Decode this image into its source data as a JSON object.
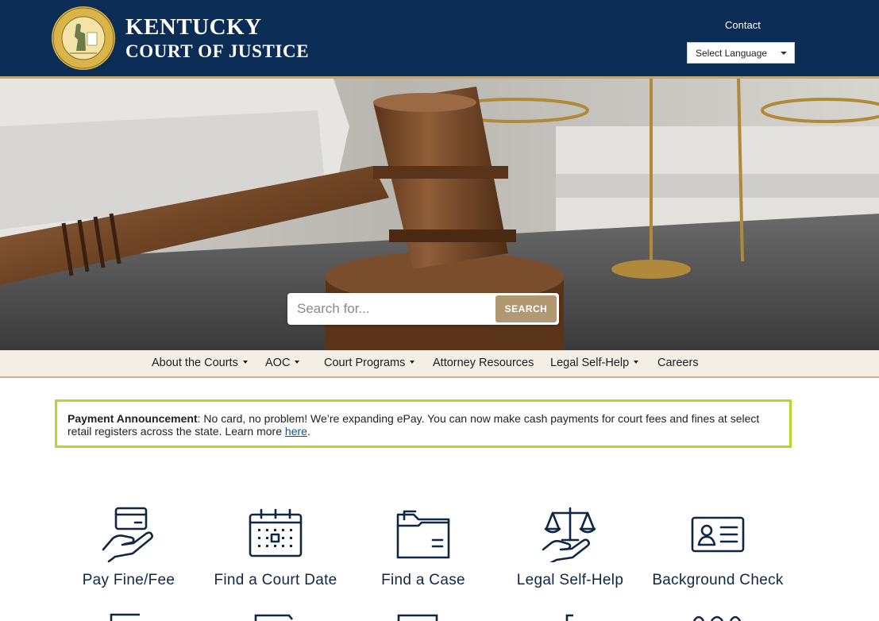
{
  "header": {
    "brand_line1": "KENTUCKY",
    "brand_line2": "COURT OF JUSTICE",
    "seal_icon": "commonwealth-of-kentucky-seal",
    "contact_label": "Contact",
    "language_select": {
      "selected": "Select Language"
    }
  },
  "hero": {
    "image": "gavel-and-scales",
    "search": {
      "placeholder": "Search for...",
      "button_label": "SEARCH"
    }
  },
  "nav": {
    "items": [
      {
        "label": "About the Courts",
        "has_dropdown": true
      },
      {
        "label": "AOC",
        "has_dropdown": true
      },
      {
        "label": "Court Programs",
        "has_dropdown": true
      },
      {
        "label": "Attorney Resources",
        "has_dropdown": false
      },
      {
        "label": "Legal Self-Help",
        "has_dropdown": true
      },
      {
        "label": "Careers",
        "has_dropdown": false
      }
    ]
  },
  "announcement": {
    "title": "Payment Announcement",
    "text": ": No card, no problem! We’re expanding ePay. You can now make cash payments for court fees and fines at select retail registers across the state. Learn more ",
    "link_label": "here",
    "suffix": "."
  },
  "services": [
    {
      "label": "Pay Fine/Fee",
      "icon": "hand-with-card-icon"
    },
    {
      "label": "Find a Court Date",
      "icon": "calendar-icon"
    },
    {
      "label": "Find a Case",
      "icon": "folder-icon"
    },
    {
      "label": "Legal Self-Help",
      "icon": "scales-in-hand-icon"
    },
    {
      "label": "Background Check",
      "icon": "id-card-icon"
    }
  ],
  "colors": {
    "header_bg": "#0b2d55",
    "accent_gold": "#bfa57a",
    "search_button": "#b09872",
    "nav_bg": "#f3eee6",
    "announcement_border": "#b4d72a",
    "icon_navy": "#0f2744"
  }
}
